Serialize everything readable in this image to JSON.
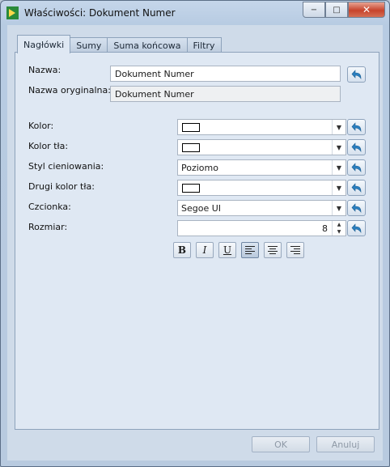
{
  "window": {
    "title": "Właściwości: Dokument Numer",
    "minimize": "−",
    "maximize": "□",
    "close": "✕"
  },
  "tabs": [
    {
      "label": "Nagłówki",
      "active": true
    },
    {
      "label": "Sumy",
      "active": false
    },
    {
      "label": "Suma końcowa",
      "active": false
    },
    {
      "label": "Filtry",
      "active": false
    }
  ],
  "fields": {
    "nazwa_label": "Nazwa:",
    "nazwa_value": "Dokument Numer",
    "nazwa_oryg_label": "Nazwa oryginalna:",
    "nazwa_oryg_value": "Dokument Numer",
    "kolor_label": "Kolor:",
    "kolor_tla_label": "Kolor tła:",
    "styl_label": "Styl cieniowania:",
    "styl_value": "Poziomo",
    "drugi_kolor_label": "Drugi kolor tła:",
    "czcionka_label": "Czcionka:",
    "czcionka_value": "Segoe UI",
    "rozmiar_label": "Rozmiar:",
    "rozmiar_value": "8"
  },
  "format": {
    "bold": "B",
    "italic": "I",
    "underline": "U",
    "align_left_active": true
  },
  "buttons": {
    "ok": "OK",
    "cancel": "Anuluj"
  },
  "icons": {
    "reset": "reset-arrow-icon",
    "dropdown": "chevron-down-icon"
  },
  "colors": {
    "accent": "#2a7fc0",
    "panel": "#dfe8f3",
    "frame": "#b8cadf"
  }
}
